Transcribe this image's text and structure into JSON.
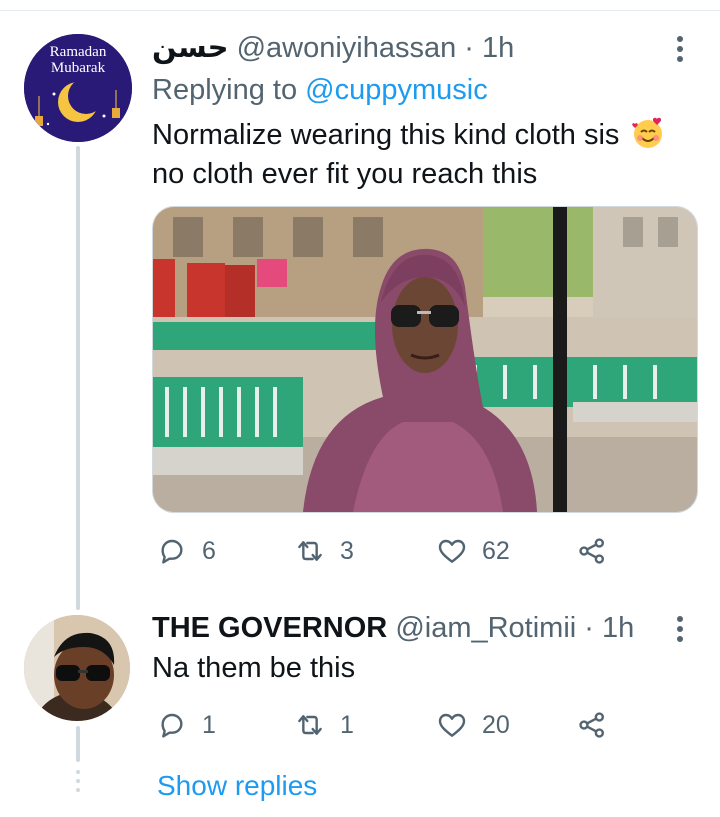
{
  "tweet1": {
    "avatar_text_line1": "Ramadan",
    "avatar_text_line2": "Mubarak",
    "display_name": "حسن",
    "handle": "@awoniyihassan",
    "separator": " · ",
    "time": "1h",
    "replying_label": "Replying to",
    "replying_handle": "@cuppymusic",
    "text_line1": "Normalize wearing this kind cloth sis",
    "emoji": "smiling-face-with-hearts",
    "text_line2": "no cloth ever fit you reach this",
    "replies": "6",
    "retweets": "3",
    "likes": "62"
  },
  "tweet2": {
    "display_name": "THE GOVERNOR",
    "handle": "@iam_Rotimii",
    "separator": " · ",
    "time": "1h",
    "text": "Na them be this",
    "replies": "1",
    "retweets": "1",
    "likes": "20"
  },
  "show_replies": "Show replies",
  "colors": {
    "link": "#1d9bf0",
    "muted": "#536471",
    "text": "#0f1419",
    "thread_line": "#cfd9de"
  }
}
